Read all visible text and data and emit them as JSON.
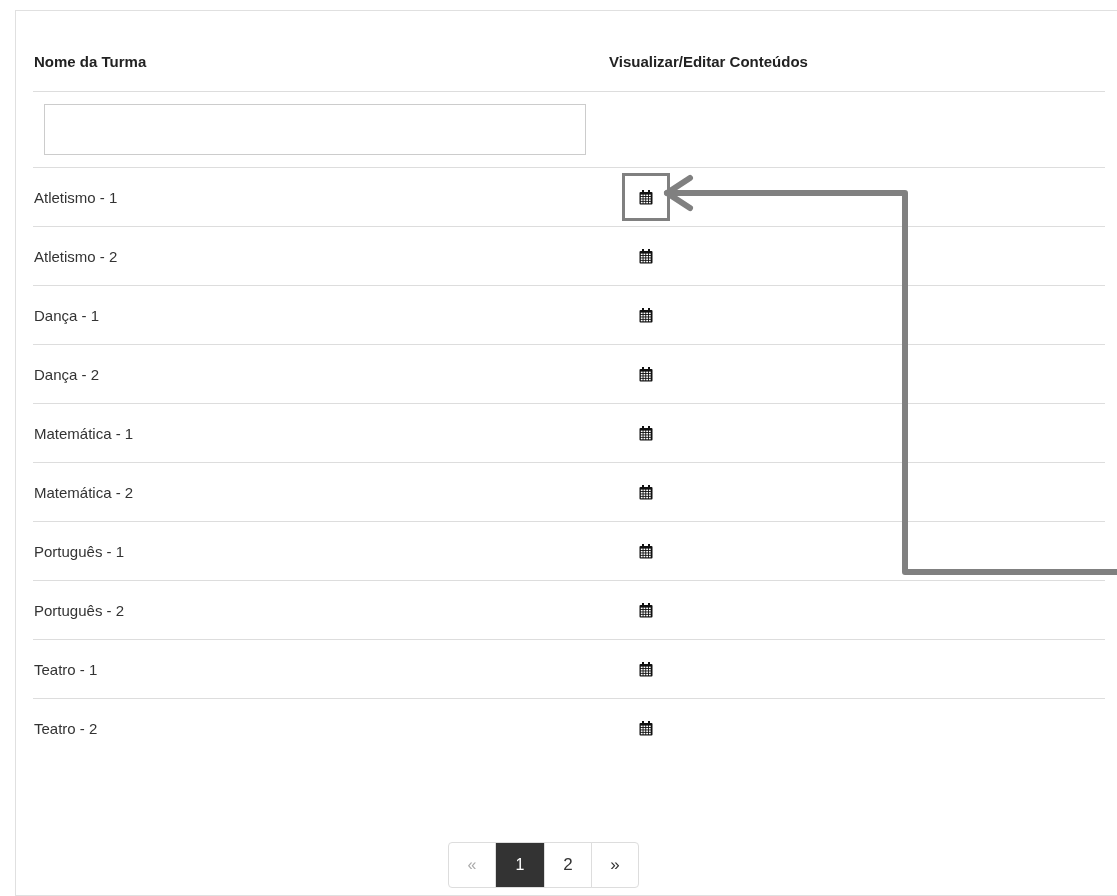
{
  "table": {
    "columns": [
      "Nome da Turma",
      "Visualizar/Editar Conteúdos"
    ],
    "rows": [
      {
        "name": "Atletismo - 1",
        "highlighted": true
      },
      {
        "name": "Atletismo - 2",
        "highlighted": false
      },
      {
        "name": "Dança - 1",
        "highlighted": false
      },
      {
        "name": "Dança - 2",
        "highlighted": false
      },
      {
        "name": "Matemática - 1",
        "highlighted": false
      },
      {
        "name": "Matemática - 2",
        "highlighted": false
      },
      {
        "name": "Português - 1",
        "highlighted": false
      },
      {
        "name": "Português - 2",
        "highlighted": false
      },
      {
        "name": "Teatro - 1",
        "highlighted": false
      },
      {
        "name": "Teatro - 2",
        "highlighted": false
      }
    ]
  },
  "pagination": [
    {
      "label": "«",
      "disabled": true,
      "selected": false
    },
    {
      "label": "1",
      "disabled": false,
      "selected": true
    },
    {
      "label": "2",
      "disabled": false,
      "selected": false
    },
    {
      "label": "»",
      "disabled": false,
      "selected": false
    }
  ]
}
